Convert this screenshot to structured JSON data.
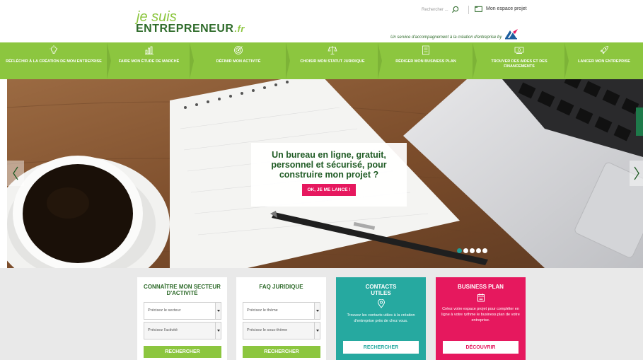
{
  "header": {
    "logo_line1": "je suis",
    "logo_line2": "ENTREPRENEUR",
    "logo_suffix": ".fr",
    "search_placeholder": "Rechercher ...",
    "espace_label": "Mon espace projet",
    "service_text": "Un service d'accompagnement à la création d'entreprise by"
  },
  "nav": {
    "items": [
      {
        "label": "RÉFLÉCHIR À LA CRÉATION DE MON ENTREPRISE",
        "icon": "lightbulb-icon"
      },
      {
        "label": "FAIRE MON ÉTUDE DE MARCHÉ",
        "icon": "bar-chart-icon"
      },
      {
        "label": "DÉFINIR MON ACTIVITÉ",
        "icon": "target-icon"
      },
      {
        "label": "CHOISIR MON STATUT JURIDIQUE",
        "icon": "scales-icon"
      },
      {
        "label": "RÉDIGER MON BUSINESS PLAN",
        "icon": "document-icon"
      },
      {
        "label": "TROUVER DES AIDES ET DES FINANCEMENTS",
        "icon": "money-icon"
      },
      {
        "label": "LANCER MON ENTREPRISE",
        "icon": "rocket-icon"
      }
    ]
  },
  "hero": {
    "title": "Un bureau en ligne, gratuit, personnel et sécurisé, pour construire mon projet ?",
    "button": "OK, JE ME LANCE !",
    "slide_count": 5,
    "active_slide": 1
  },
  "cards": {
    "secteur": {
      "title": "CONNAÎTRE MON SECTEUR D'ACTIVITÉ",
      "select1": "Précisez le secteur",
      "select2": "Précisez l'activité",
      "button": "RECHERCHER"
    },
    "faq": {
      "title": "FAQ JURIDIQUE",
      "select1": "Précisez le thème",
      "select2": "Précisez le sous-thème",
      "button": "RECHERCHER"
    },
    "contacts": {
      "title": "CONTACTS UTILES",
      "desc": "Trouvez les contacts utiles à la création d'entreprise près de chez vous.",
      "button": "RECHERCHER"
    },
    "business": {
      "title": "BUSINESS PLAN",
      "desc": "Créez votre espace projet pour compléter en ligne à votre rythme le business plan de votre entreprise.",
      "button": "DÉCOUVRIR"
    }
  },
  "colors": {
    "green": "#8cc63f",
    "dark_green": "#2e6b2a",
    "teal": "#26a9a0",
    "pink": "#e6185e"
  }
}
